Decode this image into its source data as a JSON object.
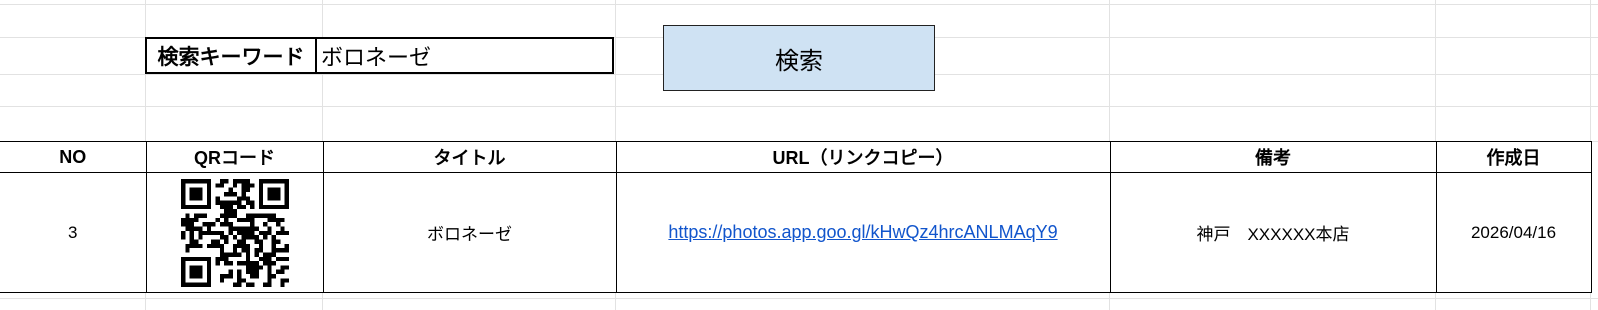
{
  "search": {
    "label": "検索キーワード",
    "value": "ボロネーゼ",
    "button_label": "検索"
  },
  "table": {
    "headers": [
      "NO",
      "QRコード",
      "タイトル",
      "URL（リンクコピー）",
      "備考",
      "作成日"
    ],
    "rows": [
      {
        "no": "3",
        "title": "ボロネーゼ",
        "url": "https://photos.app.goo.gl/kHwQz4hrcANLMAqY9",
        "note": "神戸　XXXXXX本店",
        "created": "2026/04/16"
      }
    ]
  },
  "colors": {
    "button_bg": "#cfe2f3",
    "link": "#1155cc",
    "gridline": "#e2e2e2"
  }
}
